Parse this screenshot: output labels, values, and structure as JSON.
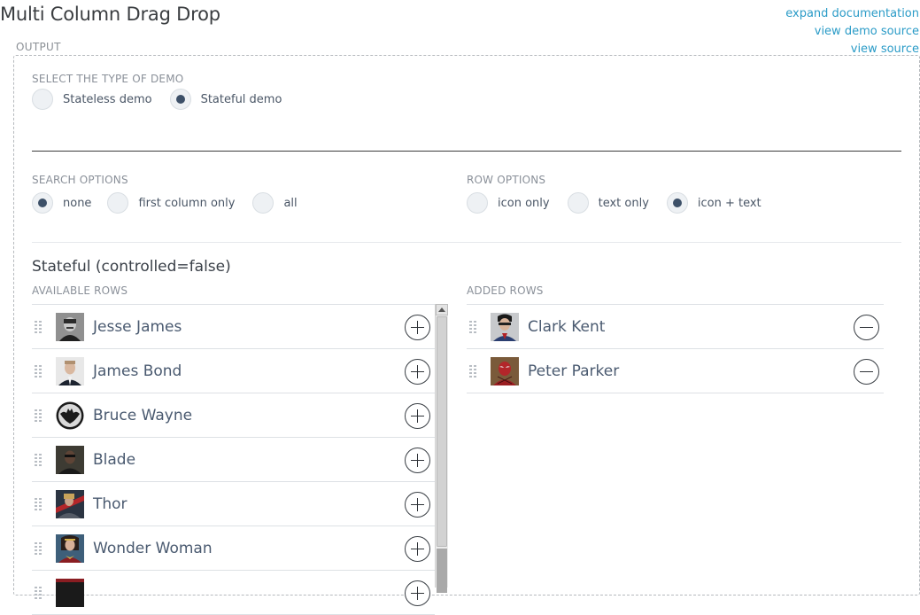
{
  "page": {
    "title": "Multi Column Drag Drop"
  },
  "links": [
    "expand documentation",
    "view demo source",
    "view source"
  ],
  "output": {
    "label": "OUTPUT"
  },
  "demo_type": {
    "label": "SELECT THE TYPE OF DEMO",
    "options": [
      "Stateless demo",
      "Stateful demo"
    ],
    "selected": "Stateful demo"
  },
  "search_options": {
    "label": "SEARCH OPTIONS",
    "options": [
      "none",
      "first column only",
      "all"
    ],
    "selected": "none"
  },
  "row_options": {
    "label": "ROW OPTIONS",
    "options": [
      "icon only",
      "text only",
      "icon + text"
    ],
    "selected": "icon + text"
  },
  "section": {
    "title": "Stateful (controlled=false)"
  },
  "available": {
    "label": "AVAILABLE ROWS",
    "rows": [
      "Jesse James",
      "James Bond",
      "Bruce Wayne",
      "Blade",
      "Thor",
      "Wonder Woman",
      ""
    ]
  },
  "added": {
    "label": "ADDED ROWS",
    "rows": [
      "Clark Kent",
      "Peter Parker"
    ]
  },
  "colors": {
    "accent_link": "#2a9bc7",
    "radio_selected_dot": "#3d5068",
    "text": "#4a5a70"
  }
}
